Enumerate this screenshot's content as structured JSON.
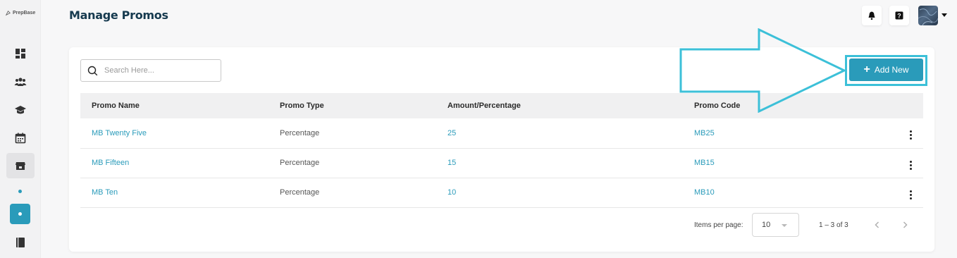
{
  "app": {
    "logo_text": "PrepBase"
  },
  "header": {
    "title": "Manage Promos"
  },
  "sidebar": {
    "items": [
      {
        "name": "dashboard-icon"
      },
      {
        "name": "users-icon"
      },
      {
        "name": "graduation-cap-icon"
      },
      {
        "name": "calendar-icon"
      },
      {
        "name": "store-icon",
        "active": true
      },
      {
        "name": "book-icon"
      }
    ]
  },
  "search": {
    "placeholder": "Search Here..."
  },
  "toolbar": {
    "add_label": "Add New"
  },
  "table": {
    "columns": [
      "Promo Name",
      "Promo Type",
      "Amount/Percentage",
      "Promo Code"
    ],
    "rows": [
      {
        "name": "MB Twenty Five",
        "type": "Percentage",
        "amount": "25",
        "code": "MB25"
      },
      {
        "name": "MB Fifteen",
        "type": "Percentage",
        "amount": "15",
        "code": "MB15"
      },
      {
        "name": "MB Ten",
        "type": "Percentage",
        "amount": "10",
        "code": "MB10"
      }
    ]
  },
  "pagination": {
    "items_per_page_label": "Items per page:",
    "items_per_page": "10",
    "range": "1 – 3 of 3"
  },
  "colors": {
    "accent": "#2a9bba",
    "annotation": "#3cc0d8",
    "title": "#163a4f"
  }
}
